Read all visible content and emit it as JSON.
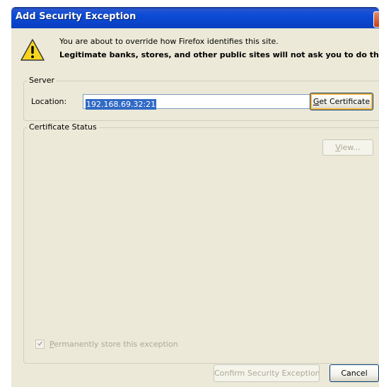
{
  "window": {
    "title": "Add Security Exception"
  },
  "warning": {
    "icon": "warning-triangle-icon",
    "line1": "You are about to override how Firefox identifies this site.",
    "line2": "Legitimate banks, stores, and other public sites will not ask you to do this."
  },
  "server": {
    "group_label": "Server",
    "location_label": "Location:",
    "location_value": "192.168.69.32:21",
    "get_certificate": {
      "access_key": "G",
      "rest": "et Certificate"
    }
  },
  "certificate_status": {
    "group_label": "Certificate Status",
    "view_button": {
      "access_key": "V",
      "rest": "iew..."
    }
  },
  "permanent": {
    "checked": true,
    "enabled": false,
    "access_key": "P",
    "rest": "ermanently store this exception"
  },
  "footer": {
    "confirm_label": "Confirm Security Exception",
    "cancel_label": "Cancel"
  },
  "colors": {
    "titlebar": "#0b4bd6",
    "dialog_bg": "#ece9d8",
    "selection": "#316ac5",
    "disabled_text": "#aca899",
    "close_button": "#c2411b"
  }
}
